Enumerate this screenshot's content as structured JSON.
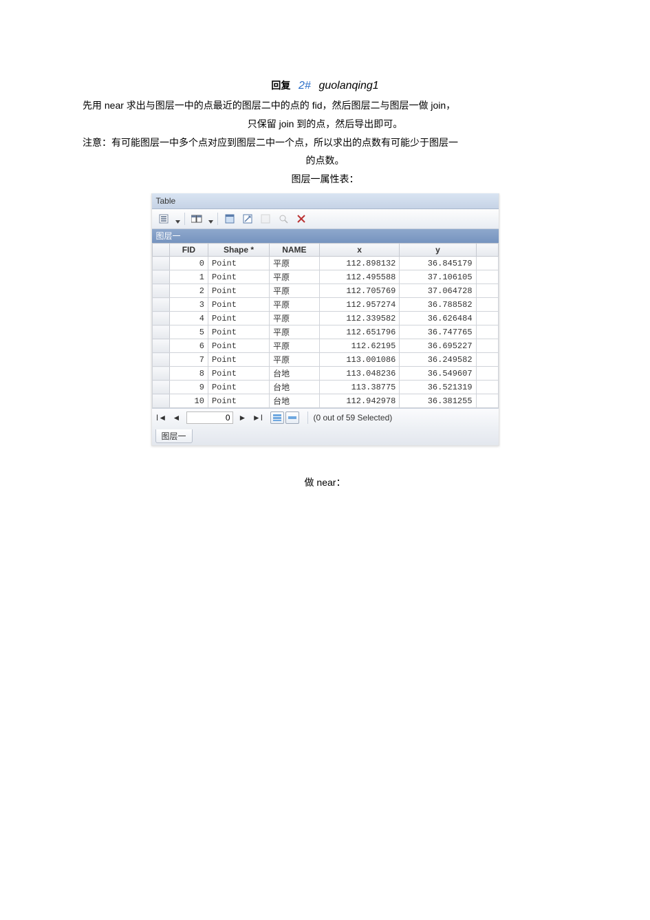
{
  "header": {
    "reply_word": "回复",
    "reply_num": "2#",
    "reply_user": "guolanqing1"
  },
  "body_text": {
    "line1": "先用 near 求出与图层一中的点最近的图层二中的点的 fid，然后图层二与图层一做 join，",
    "line2": "只保留 join 到的点，然后导出即可。",
    "line3": "注意：有可能图层一中多个点对应到图层二中一个点，所以求出的点数有可能少于图层一",
    "line4": "的点数。",
    "line5": "图层一属性表：",
    "final": "做 near："
  },
  "panel": {
    "title": "Table",
    "layer_name": "图层一",
    "bottom_tab": "图层一",
    "nav_value": "0",
    "nav_status": "(0 out of 59 Selected)",
    "columns": [
      "FID",
      "Shape *",
      "NAME",
      "x",
      "y"
    ],
    "rows": [
      {
        "fid": "0",
        "shape": "Point",
        "name": "平原",
        "x": "112.898132",
        "y": "36.845179"
      },
      {
        "fid": "1",
        "shape": "Point",
        "name": "平原",
        "x": "112.495588",
        "y": "37.106105"
      },
      {
        "fid": "2",
        "shape": "Point",
        "name": "平原",
        "x": "112.705769",
        "y": "37.064728"
      },
      {
        "fid": "3",
        "shape": "Point",
        "name": "平原",
        "x": "112.957274",
        "y": "36.788582"
      },
      {
        "fid": "4",
        "shape": "Point",
        "name": "平原",
        "x": "112.339582",
        "y": "36.626484"
      },
      {
        "fid": "5",
        "shape": "Point",
        "name": "平原",
        "x": "112.651796",
        "y": "36.747765"
      },
      {
        "fid": "6",
        "shape": "Point",
        "name": "平原",
        "x": "112.62195",
        "y": "36.695227"
      },
      {
        "fid": "7",
        "shape": "Point",
        "name": "平原",
        "x": "113.001086",
        "y": "36.249582"
      },
      {
        "fid": "8",
        "shape": "Point",
        "name": "台地",
        "x": "113.048236",
        "y": "36.549607"
      },
      {
        "fid": "9",
        "shape": "Point",
        "name": "台地",
        "x": "113.38775",
        "y": "36.521319"
      },
      {
        "fid": "10",
        "shape": "Point",
        "name": "台地",
        "x": "112.942978",
        "y": "36.381255"
      }
    ]
  }
}
